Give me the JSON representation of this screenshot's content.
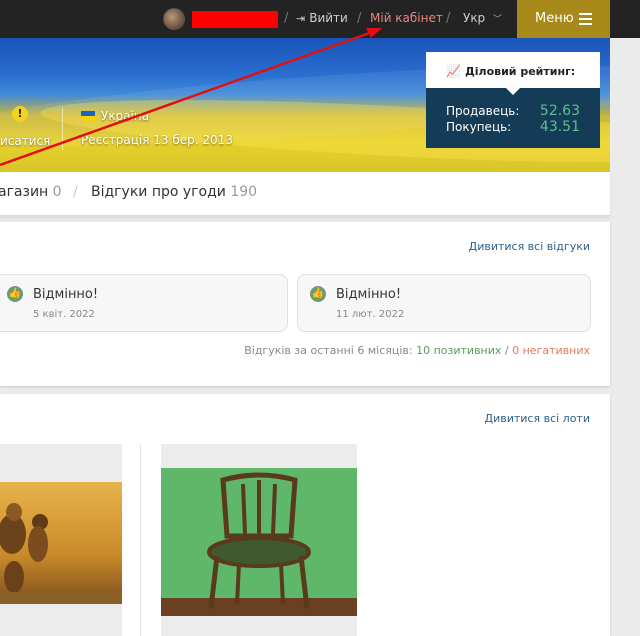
{
  "topbar": {
    "logout_label": "Вийти",
    "cabinet_label": "Мій кабінет",
    "language": "Укр",
    "menu_label": "Меню",
    "accent_color": "#a88a1a",
    "cabinet_color": "#e9847d"
  },
  "profile": {
    "action_label": "исатися",
    "country": "Україна",
    "registration": "Реєстрація 13 бер. 2013"
  },
  "rating": {
    "title": "Діловий рейтинг:",
    "seller_label": "Продавець:",
    "seller_value": "52.63",
    "buyer_label": "Покупець:",
    "buyer_value": "43.51"
  },
  "tabs": [
    {
      "label": "агазин",
      "count": "0"
    },
    {
      "label": "Відгуки про угоди",
      "count": "190"
    }
  ],
  "reviews": {
    "see_all": "Дивитися всі відгуки",
    "items": [
      {
        "title": "Відмінно!",
        "date": "5 квіт. 2022"
      },
      {
        "title": "Відмінно!",
        "date": "11 лют. 2022"
      }
    ],
    "summary_prefix": "Відгуків за останні 6 місяців:",
    "positive": "10 позитивних",
    "slash": "/",
    "negative": "0 негативних"
  },
  "lots": {
    "see_all": "Дивитися всі лоти"
  }
}
